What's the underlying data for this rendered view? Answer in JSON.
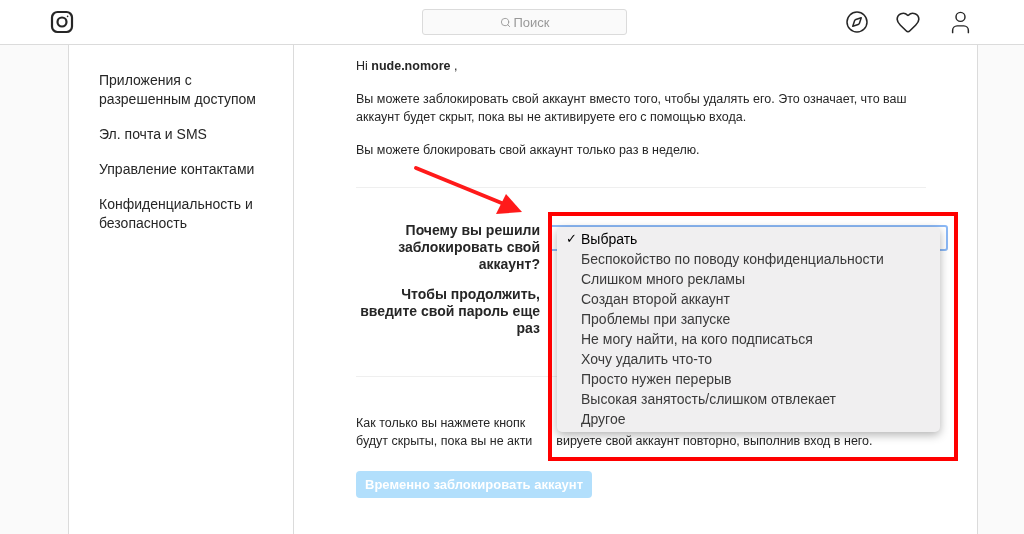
{
  "header": {
    "search": {
      "placeholder": "Поиск"
    }
  },
  "sidebar": {
    "items": [
      {
        "label": "Приложения с разрешенным доступом",
        "selected": false
      },
      {
        "label": "Эл. почта и SMS",
        "selected": false
      },
      {
        "label": "Управление контактами",
        "selected": false
      },
      {
        "label": "Конфиденциальность и безопасность",
        "selected": false
      }
    ]
  },
  "greeting": "Hi **nude.nomore** ,",
  "paragraphs": [
    "Вы можете заблокировать свой аккаунт вместо того, чтобы удалять его. Это означает, что ваш аккаунт будет скрыт, пока вы не активируете его с помощью входа.",
    "Вы можете блокировать свой аккаунт только раз в неделю."
  ],
  "form": {
    "reason_label": "Почему вы решили заблокировать свой аккаунт?",
    "password_label": "Чтобы продолжить, введите свой пароль еще раз"
  },
  "dropdown": {
    "options": [
      {
        "label": "Выбрать",
        "selected": true
      },
      {
        "label": "Беспокойство по поводу конфиденциальности",
        "selected": false
      },
      {
        "label": "Слишком много рекламы",
        "selected": false
      },
      {
        "label": "Создан второй аккаунт",
        "selected": false
      },
      {
        "label": "Проблемы при запуске",
        "selected": false
      },
      {
        "label": "Не могу найти, на кого подписаться",
        "selected": false
      },
      {
        "label": "Хочу удалить что-то",
        "selected": false
      },
      {
        "label": "Просто нужен перерыв",
        "selected": false
      },
      {
        "label": "Высокая занятость/слишком отвлекает",
        "selected": false
      },
      {
        "label": "Другое",
        "selected": false
      }
    ],
    "check_mark": "✓"
  },
  "note_lines": [
    "Как только вы нажмете кнопк",
    "будут скрыты, пока вы не акти",
    "вируете свой аккаунт повторно, выполнив вход в него."
  ],
  "submit_button": {
    "label": "Временно заблокировать аккаунт",
    "disabled": true
  }
}
